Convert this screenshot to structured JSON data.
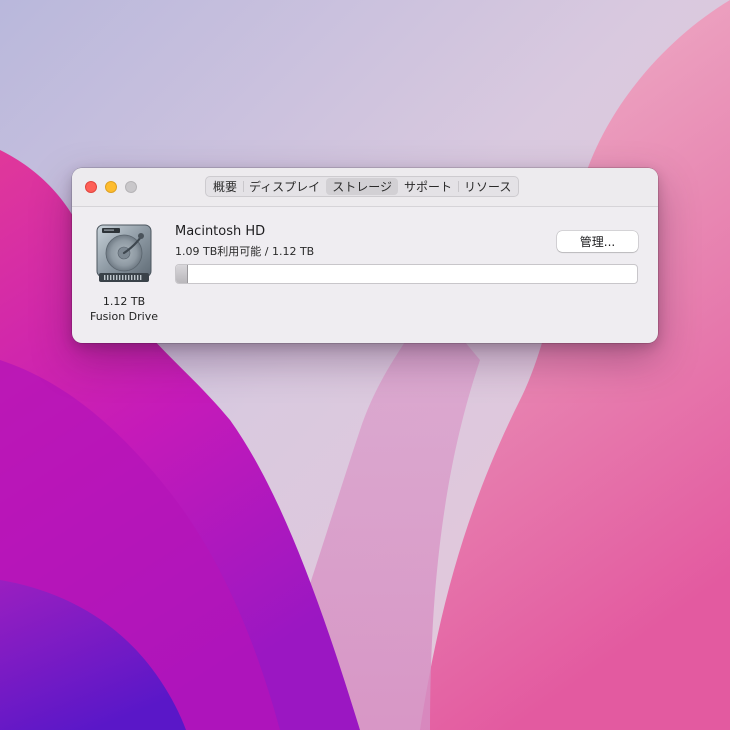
{
  "window": {
    "tabs": [
      {
        "label": "概要",
        "selected": false
      },
      {
        "label": "ディスプレイ",
        "selected": false
      },
      {
        "label": "ストレージ",
        "selected": true
      },
      {
        "label": "サポート",
        "selected": false
      },
      {
        "label": "リソース",
        "selected": false
      }
    ]
  },
  "drive": {
    "size": "1.12 TB",
    "type": "Fusion Drive",
    "icon": "hard-drive-icon"
  },
  "volume": {
    "name": "Macintosh HD",
    "space": "1.09 TB利用可能 / 1.12 TB",
    "manage_label": "管理...",
    "used_fraction": 0.025
  },
  "colors": {
    "close": "#fe5f57",
    "minimize": "#febc2e",
    "zoom_inactive": "#c9c7ca"
  }
}
